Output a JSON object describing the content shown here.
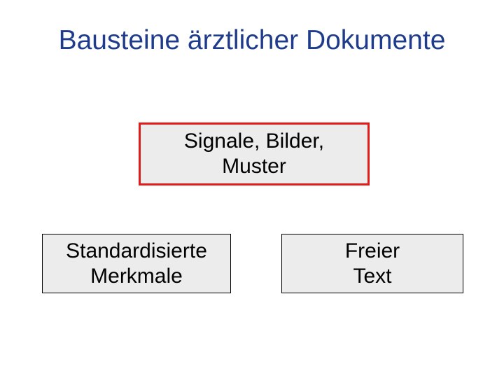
{
  "title": "Bausteine ärztlicher Dokumente",
  "boxes": {
    "top": {
      "line1": "Signale, Bilder,",
      "line2": "Muster"
    },
    "bottomLeft": {
      "line1": "Standardisierte",
      "line2": "Merkmale"
    },
    "bottomRight": {
      "line1": "Freier",
      "line2": "Text"
    }
  }
}
